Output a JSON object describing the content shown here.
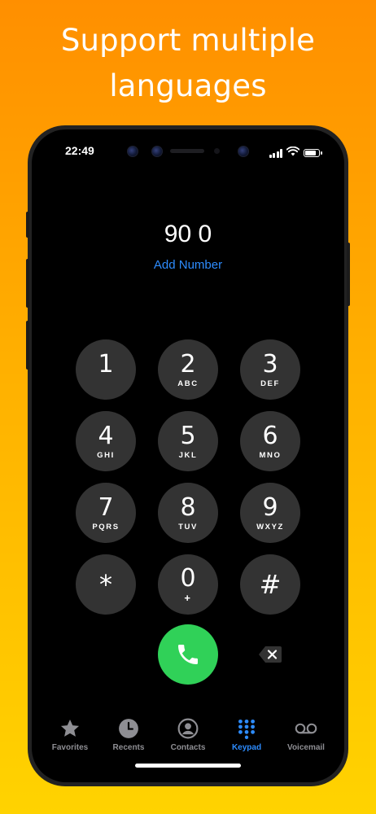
{
  "promo": {
    "headline": "Support multiple\nlanguages"
  },
  "status_bar": {
    "time": "22:49",
    "battery_level": 0.85
  },
  "dialer": {
    "entered_number": "90 0",
    "add_number_label": "Add Number"
  },
  "keypad": {
    "keys": [
      {
        "digit": "1",
        "letters": ""
      },
      {
        "digit": "2",
        "letters": "ABC"
      },
      {
        "digit": "3",
        "letters": "DEF"
      },
      {
        "digit": "4",
        "letters": "GHI"
      },
      {
        "digit": "5",
        "letters": "JKL"
      },
      {
        "digit": "6",
        "letters": "MNO"
      },
      {
        "digit": "7",
        "letters": "PQRS"
      },
      {
        "digit": "8",
        "letters": "TUV"
      },
      {
        "digit": "9",
        "letters": "WXYZ"
      },
      {
        "digit": "*",
        "letters": ""
      },
      {
        "digit": "0",
        "letters": "+"
      },
      {
        "digit": "#",
        "letters": ""
      }
    ]
  },
  "tab_bar": {
    "tabs": [
      {
        "label": "Favorites",
        "icon": "star-icon"
      },
      {
        "label": "Recents",
        "icon": "clock-icon"
      },
      {
        "label": "Contacts",
        "icon": "person-circle-icon"
      },
      {
        "label": "Keypad",
        "icon": "keypad-grid-icon",
        "active": true
      },
      {
        "label": "Voicemail",
        "icon": "voicemail-icon"
      }
    ]
  },
  "colors": {
    "accent": "#2d8cff",
    "call_green": "#30d158",
    "key_background": "#333333",
    "inactive_tab": "#8e8e93"
  }
}
